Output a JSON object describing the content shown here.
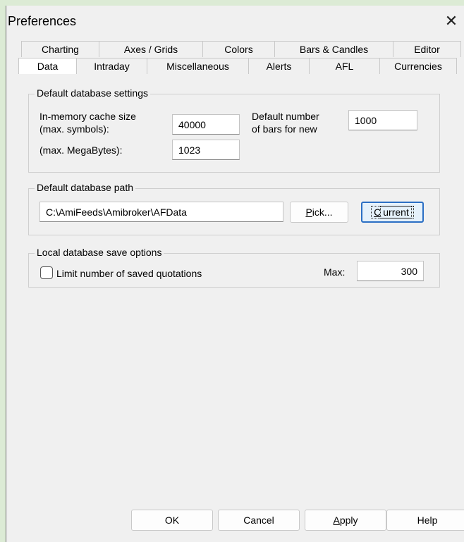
{
  "window": {
    "title": "Preferences",
    "close_glyph": "✕"
  },
  "tabs_back": [
    "Charting",
    "Axes / Grids",
    "Colors",
    "Bars & Candles",
    "Editor"
  ],
  "tabs_front": [
    "Data",
    "Intraday",
    "Miscellaneous",
    "Alerts",
    "AFL",
    "Currencies"
  ],
  "active_tab": "Data",
  "db_settings": {
    "title": "Default database settings",
    "cache_label_1": "In-memory cache size",
    "cache_label_2": "(max. symbols):",
    "cache_symbols": "40000",
    "megabytes_label": "(max. MegaBytes):",
    "cache_megabytes": "1023",
    "bars_label_1": "Default number",
    "bars_label_2": "of bars for new",
    "default_bars": "1000"
  },
  "db_path": {
    "title": "Default database path",
    "path": "C:\\AmiFeeds\\Amibroker\\AFData",
    "pick_label": "Pick...",
    "current_label": "Current"
  },
  "save_options": {
    "title": "Local database save options",
    "limit_label": "Limit number of saved quotations",
    "max_label": "Max:",
    "max_value": "300"
  },
  "footer": {
    "ok": "OK",
    "cancel": "Cancel",
    "apply": "Apply",
    "help": "Help"
  }
}
